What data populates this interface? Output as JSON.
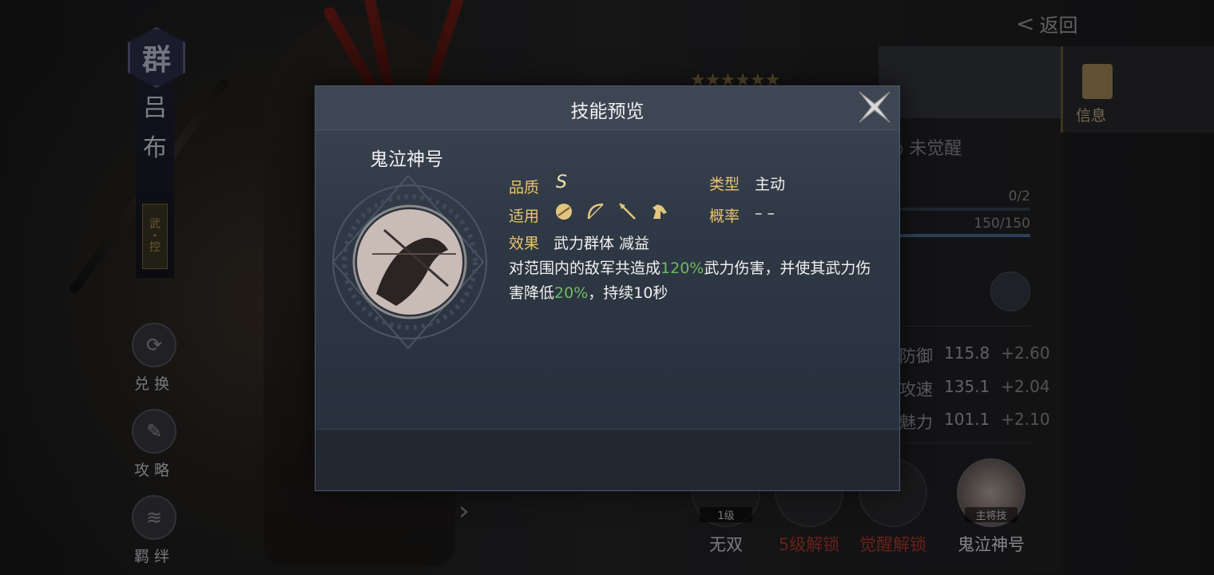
{
  "hero": {
    "faction": "群",
    "name_chars": [
      "吕",
      "布"
    ],
    "type_badge": [
      "武",
      "•",
      "控"
    ]
  },
  "left_menu": [
    {
      "label": "兑换",
      "icon": "exchange-icon"
    },
    {
      "label": "攻略",
      "icon": "scroll-icon"
    },
    {
      "label": "羁绊",
      "icon": "bond-icon"
    }
  ],
  "header": {
    "back_label": "返回"
  },
  "right_panel": {
    "info_tab_label": "信息",
    "awaken_status": "未觉醒",
    "bar1_value": "0/2",
    "bar2_value": "150/150",
    "stats": [
      {
        "name": "防御",
        "value": "115.8",
        "gain": "+2.60"
      },
      {
        "name": "攻速",
        "value": "135.1",
        "gain": "+2.04"
      },
      {
        "name": "魅力",
        "value": "101.1",
        "gain": "+2.10"
      }
    ],
    "skill_slots": [
      {
        "label": "无双",
        "tag": "1级",
        "color": "#d8d8dc"
      },
      {
        "label": "5级解锁",
        "tag": "",
        "color": "#b13a2e"
      },
      {
        "label": "觉醒解锁",
        "tag": "",
        "color": "#b13a2e"
      },
      {
        "label": "鬼泣神号",
        "tag": "主将技",
        "color": "#e6e6ea"
      }
    ]
  },
  "dialog": {
    "title": "技能预览",
    "skill_name": "鬼泣神号",
    "quality_label": "品质",
    "quality_value": "S",
    "type_label": "类型",
    "type_value": "主动",
    "apply_label": "适用",
    "apply_units": [
      "shield-unit-icon",
      "bow-unit-icon",
      "spear-unit-icon",
      "cavalry-unit-icon"
    ],
    "chance_label": "概率",
    "chance_value": "– –",
    "effect_label": "效果",
    "effect_value": "武力群体 减益",
    "desc_parts": {
      "p1": "对范围内的敌军共造成",
      "h1": "120%",
      "p2": "武力伤害，并使其武力伤害降低",
      "h2": "20%",
      "p3": "，持续10秒"
    }
  },
  "colors": {
    "highlight": "#6dbb5e",
    "label_gold": "#e9c46a"
  }
}
